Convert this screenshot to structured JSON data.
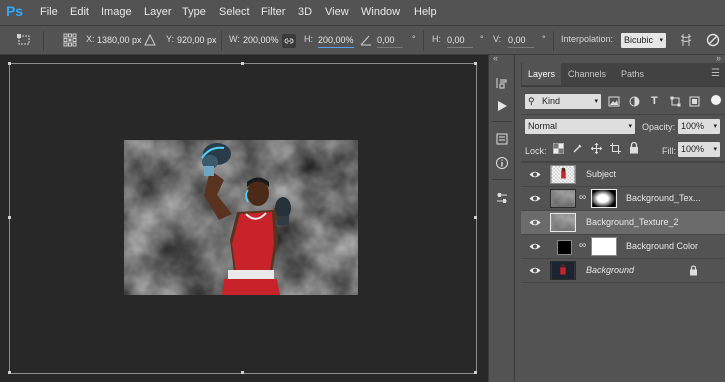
{
  "app": {
    "logo": "Ps"
  },
  "menu": [
    "File",
    "Edit",
    "Image",
    "Layer",
    "Type",
    "Select",
    "Filter",
    "3D",
    "View",
    "Window",
    "Help"
  ],
  "options": {
    "x_label": "X:",
    "x_value": "1380,00 px",
    "y_label": "Y:",
    "y_value": "920,00 px",
    "w_label": "W:",
    "w_value": "200,00%",
    "h_label": "H:",
    "h_value": "200,00%",
    "angle_value": "0,00",
    "angle_unit": "°",
    "hskew_label": "H:",
    "hskew_value": "0,00",
    "hskew_unit": "°",
    "vskew_label": "V:",
    "vskew_value": "0,00",
    "vskew_unit": "°",
    "interp_label": "Interpolation:",
    "interp_value": "Bicubic"
  },
  "panel": {
    "collapse_glyph": "«",
    "expand_glyph": "»",
    "tabs": [
      "Layers",
      "Channels",
      "Paths"
    ],
    "filter_kind": "Kind",
    "blend_mode": "Normal",
    "opacity_label": "Opacity:",
    "opacity_value": "100%",
    "lock_label": "Lock:",
    "fill_label": "Fill:",
    "fill_value": "100%",
    "layers": [
      {
        "name": "Subject",
        "italic": false,
        "selected": false
      },
      {
        "name": "Background_Tex...",
        "italic": false,
        "selected": false
      },
      {
        "name": "Background_Texture_2",
        "italic": false,
        "selected": true
      },
      {
        "name": "Background Color",
        "italic": false,
        "selected": false
      },
      {
        "name": "Background",
        "italic": true,
        "selected": false
      }
    ]
  }
}
